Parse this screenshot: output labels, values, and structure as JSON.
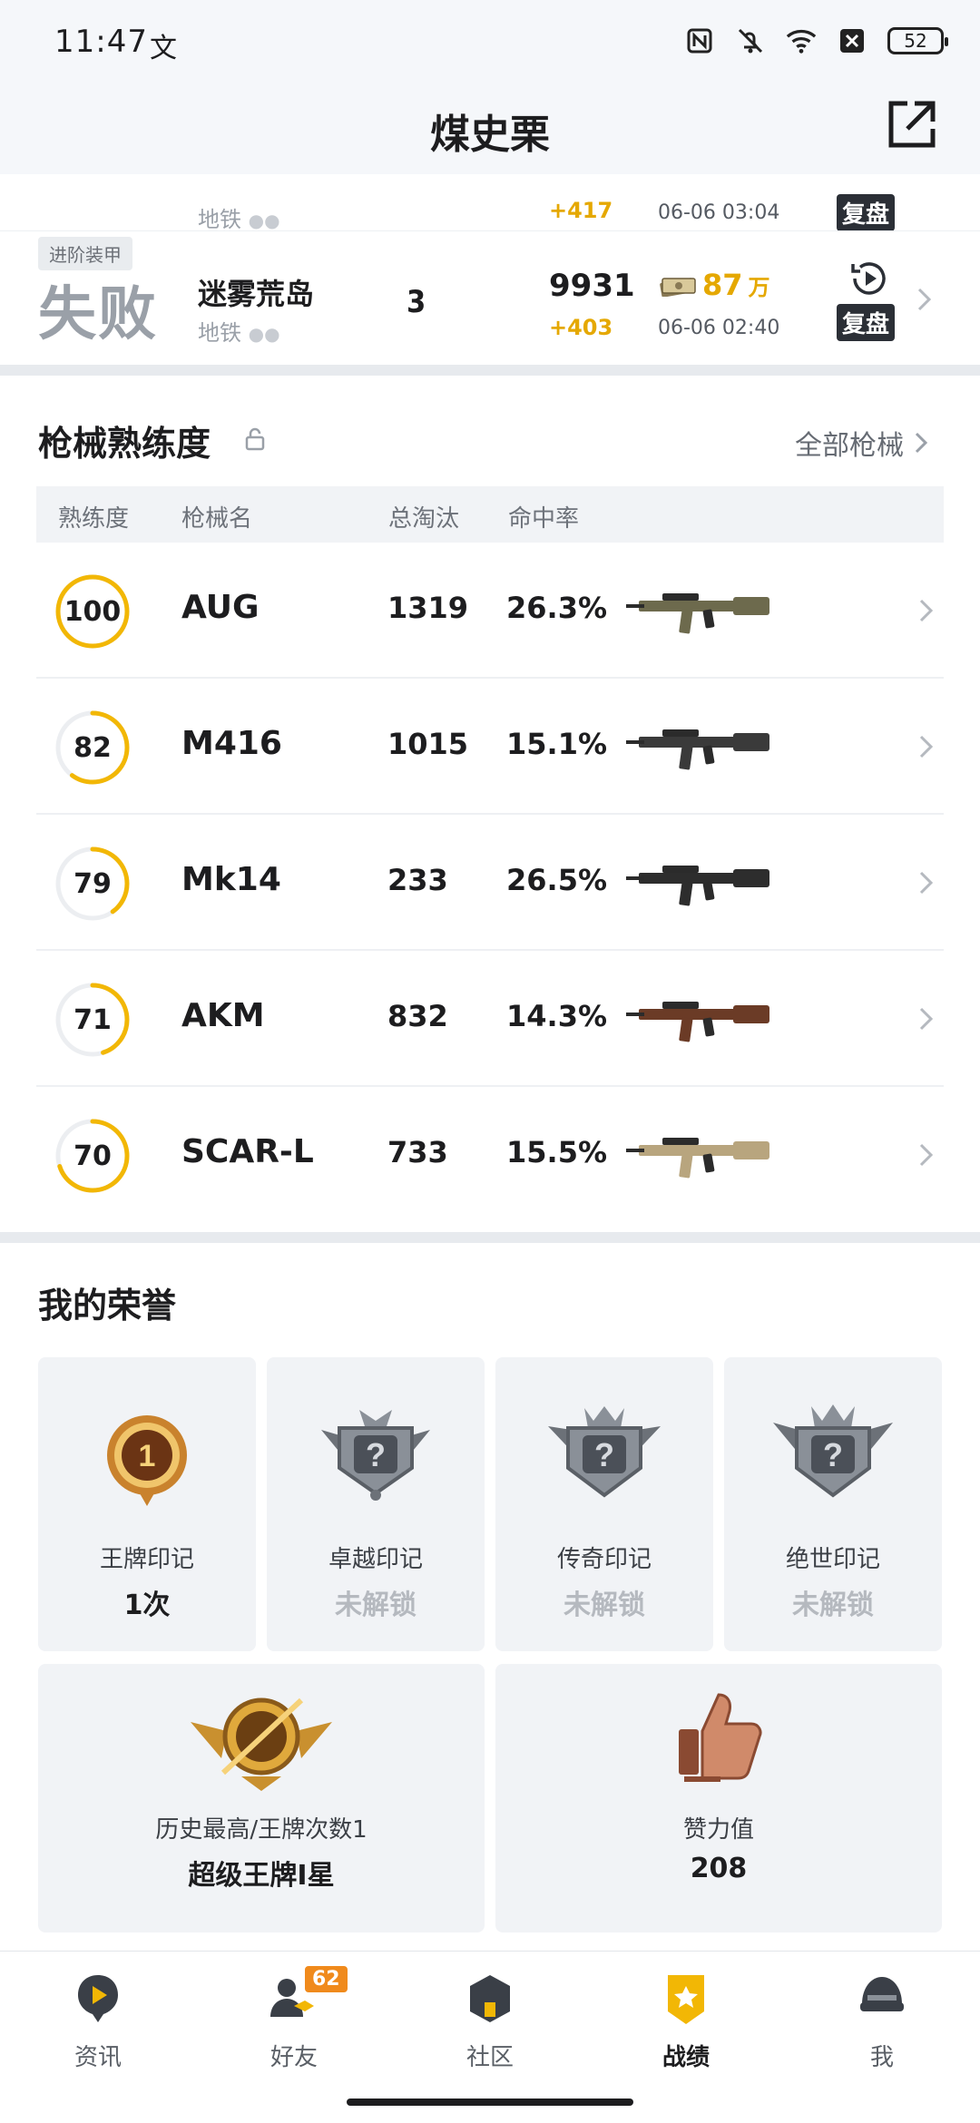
{
  "status_bar": {
    "time": "11:47",
    "glyph": "文",
    "battery": "52"
  },
  "header": {
    "title": "煤史栗"
  },
  "match_history": {
    "partial_row": {
      "sub_mode": "地铁",
      "score_gain": "+417",
      "time": "06-06 03:04",
      "replay": "复盘"
    },
    "row": {
      "mode_tag": "进阶装甲",
      "result": "失败",
      "map": "迷雾荒岛",
      "sub_mode": "地铁",
      "placement": "3",
      "score": "9931",
      "score_gain": "+403",
      "money": "87",
      "money_unit": "万",
      "time": "06-06 02:40",
      "replay": "复盘"
    }
  },
  "weapons": {
    "title": "枪械熟练度",
    "all_link": "全部枪械",
    "headers": [
      "熟练度",
      "枪械名",
      "总淘汰",
      "命中率"
    ],
    "rows": [
      {
        "proficiency": "100",
        "level": 1.0,
        "name": "AUG",
        "kills": "1319",
        "hit_rate": "26.3%",
        "image": "aug-rifle",
        "color": "#6d6a4d"
      },
      {
        "proficiency": "82",
        "level": 0.6,
        "name": "M416",
        "kills": "1015",
        "hit_rate": "15.1%",
        "image": "m416-rifle",
        "color": "#3a3a3a"
      },
      {
        "proficiency": "79",
        "level": 0.4,
        "name": "Mk14",
        "kills": "233",
        "hit_rate": "26.5%",
        "image": "mk14-rifle",
        "color": "#2d2d2d"
      },
      {
        "proficiency": "71",
        "level": 0.45,
        "name": "AKM",
        "kills": "832",
        "hit_rate": "14.3%",
        "image": "akm-rifle",
        "color": "#6b3b26"
      },
      {
        "proficiency": "70",
        "level": 0.7,
        "name": "SCAR-L",
        "kills": "733",
        "hit_rate": "15.5%",
        "image": "scar-l-rifle",
        "color": "#b8a57e"
      }
    ]
  },
  "honors": {
    "title": "我的荣誉",
    "cards": [
      {
        "label": "王牌印记",
        "value": "1次",
        "locked": false,
        "icon": "ace-badge-icon"
      },
      {
        "label": "卓越印记",
        "value": "未解锁",
        "locked": true,
        "icon": "locked-badge-icon"
      },
      {
        "label": "传奇印记",
        "value": "未解锁",
        "locked": true,
        "icon": "locked-badge-icon"
      },
      {
        "label": "绝世印记",
        "value": "未解锁",
        "locked": true,
        "icon": "locked-badge-icon"
      }
    ],
    "rank_card": {
      "label": "历史最高/王牌次数1",
      "value": "超级王牌I星",
      "icon": "ace-rank-emblem-icon"
    },
    "likes_card": {
      "label": "赞力值",
      "value": "208",
      "icon": "thumbs-up-icon"
    }
  },
  "nav": {
    "items": [
      {
        "label": "资讯",
        "icon": "news-icon"
      },
      {
        "label": "好友",
        "icon": "friends-icon",
        "badge": "62"
      },
      {
        "label": "社区",
        "icon": "community-icon"
      },
      {
        "label": "战绩",
        "icon": "record-icon",
        "active": true
      },
      {
        "label": "我",
        "icon": "helmet-icon"
      }
    ]
  },
  "colors": {
    "accent": "#f2b705",
    "gold": "#e5a800",
    "text": "#1d1d1f",
    "muted": "#9aa0a8"
  }
}
